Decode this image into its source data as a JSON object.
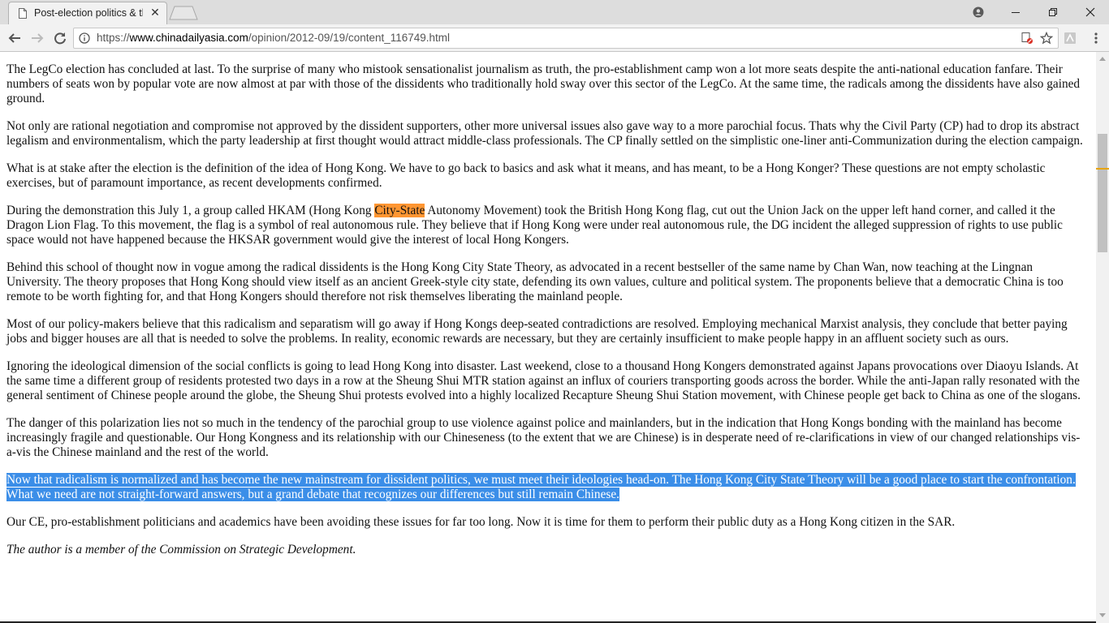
{
  "tab": {
    "title": "Post-election politics & th",
    "close_glyph": "✕"
  },
  "toolbar": {
    "url_scheme": "https://",
    "url_host": "www.chinadailyasia.com",
    "url_path": "/opinion/2012-09/19/content_116749.html"
  },
  "article": {
    "paragraphs": [
      "The LegCo election has concluded at last. To the surprise of many who mistook sensationalist journalism as truth, the pro-establishment camp won a lot more seats despite the anti-national education fanfare. Their numbers of seats won by popular vote are now almost at par with those of the dissidents who traditionally hold sway over this sector of the LegCo. At the same time, the radicals among the dissidents have also gained ground.",
      "Not only are rational negotiation and compromise not approved by the dissident supporters, other more universal issues also gave way to a more parochial focus. Thats why the Civil Party (CP) had to drop its abstract legalism and environmentalism, which the party leadership at first thought would attract middle-class professionals. The CP finally settled on the simplistic one-liner anti-Communization during the election campaign.",
      "What is at stake after the election is the definition of the idea of Hong Kong. We have to go back to basics and ask what it means, and has meant, to be a Hong Konger? These questions are not empty scholastic exercises, but of paramount importance, as recent developments confirmed."
    ],
    "p4_before": "During the demonstration this July 1, a group called HKAM (Hong Kong ",
    "p4_highlight": "City-State",
    "p4_after": " Autonomy Movement) took the British Hong Kong flag, cut out the Union Jack on the upper left hand corner, and called it the Dragon Lion Flag. To this movement, the flag is a symbol of real autonomous rule. They believe that if Hong Kong were under real autonomous rule, the DG incident the alleged suppression of rights to use public space would not have happened because the HKSAR government would give the interest of local Hong Kongers.",
    "paragraphs_b": [
      "Behind this school of thought now in vogue among the radical dissidents is the Hong Kong City State Theory, as advocated in a recent bestseller of the same name by Chan Wan, now teaching at the Lingnan University. The theory proposes that Hong Kong should view itself as an ancient Greek-style city state, defending its own values, culture and political system. The proponents believe that a democratic China is too remote to be worth fighting for, and that Hong Kongers should therefore not risk themselves liberating the mainland people.",
      "Most of our policy-makers believe that this radicalism and separatism will go away if Hong Kongs deep-seated contradictions are resolved. Employing mechanical Marxist analysis, they conclude that better paying jobs and bigger houses are all that is needed to solve the problems. In reality, economic rewards are necessary, but they are certainly insufficient to make people happy in an affluent society such as ours.",
      "Ignoring the ideological dimension of the social conflicts is going to lead Hong Kong into disaster. Last weekend, close to a thousand Hong Kongers demonstrated against Japans provocations over Diaoyu Islands. At the same time a different group of residents protested two days in a row at the Sheung Shui MTR station against an influx of couriers transporting goods across the border. While the anti-Japan rally resonated with the general sentiment of Chinese people around the globe, the Sheung Shui protests evolved into a highly localized Recapture Sheung Shui Station movement, with Chinese people get back to China as one of the slogans.",
      "The danger of this polarization lies not so much in the tendency of the parochial group to use violence against police and mainlanders, but in the indication that Hong Kongs bonding with the mainland has become increasingly fragile and questionable. Our Hong Kongness and its relationship with our Chineseness (to the extent that we are Chinese) is in desperate need of re-clarifications in view of our changed relationships vis-a-vis the Chinese mainland and the rest of the world."
    ],
    "selected_paragraph": "Now that radicalism is normalized and has become the new mainstream for dissident politics, we must meet their ideologies head-on. The Hong Kong City State Theory will be a good place to start the confrontation. What we need are not straight-forward answers, but a grand debate that recognizes our differences but still remain Chinese.",
    "final_paragraph": "Our CE, pro-establishment politicians and academics have been avoiding these issues for far too long. Now it is time for them to perform their public duty as a Hong Kong citizen in the SAR.",
    "byline": "The author is a member of the Commission on Strategic Development."
  },
  "colors": {
    "find_highlight": "#ff9632",
    "selection": "#3b8ee8",
    "find_marker": "#e8a400"
  },
  "icons": [
    "page-icon",
    "close-icon",
    "new-tab-icon",
    "profile-icon",
    "minimize-icon",
    "maximize-icon",
    "window-close-icon",
    "back-arrow-icon",
    "forward-arrow-icon",
    "reload-icon",
    "info-icon",
    "blocked-popup-icon",
    "star-icon",
    "extension-icon",
    "menu-icon",
    "scroll-up-icon",
    "scroll-down-icon"
  ]
}
